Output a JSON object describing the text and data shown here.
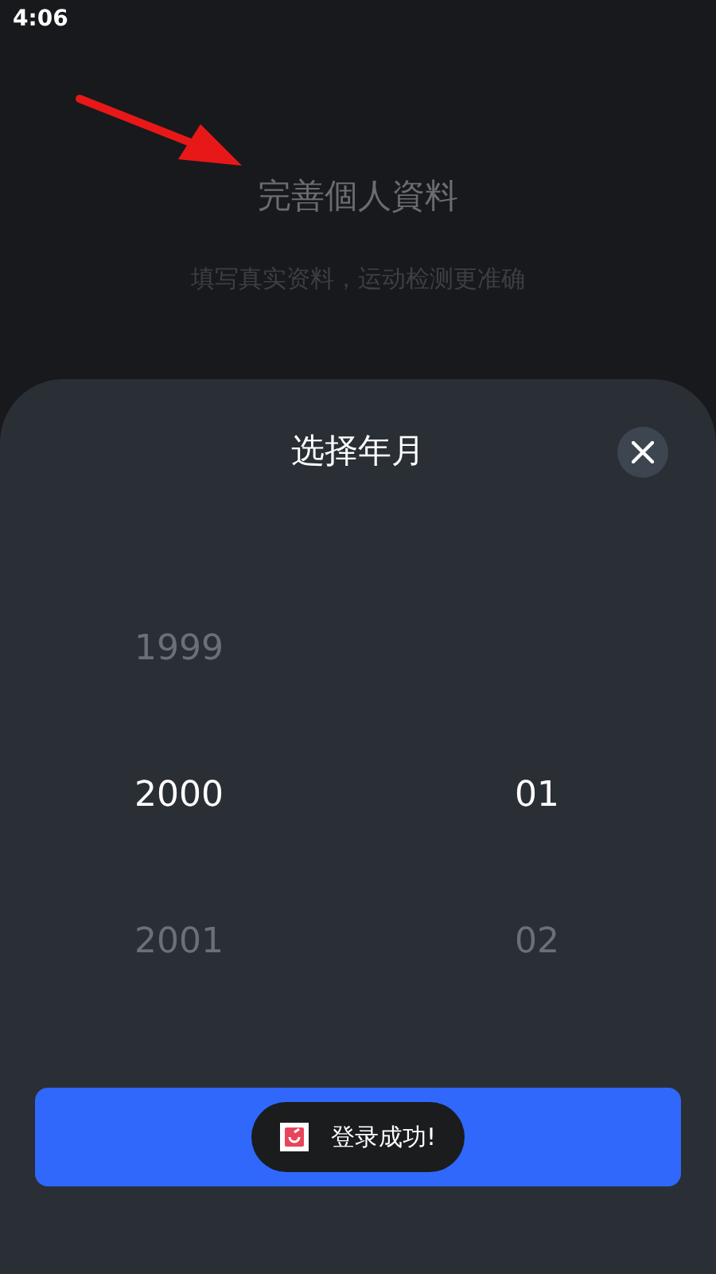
{
  "status_bar": {
    "time": "4:06"
  },
  "header": {
    "title": "完善個人資料",
    "subtitle": "填写真实资料，运动检测更准确"
  },
  "sheet": {
    "title": "选择年月",
    "years": [
      {
        "label": "1999",
        "selected": false
      },
      {
        "label": "2000",
        "selected": true
      },
      {
        "label": "2001",
        "selected": false
      }
    ],
    "months": [
      {
        "label": "01",
        "selected": true
      },
      {
        "label": "02",
        "selected": false
      }
    ]
  },
  "toast": {
    "text": "登录成功!"
  }
}
